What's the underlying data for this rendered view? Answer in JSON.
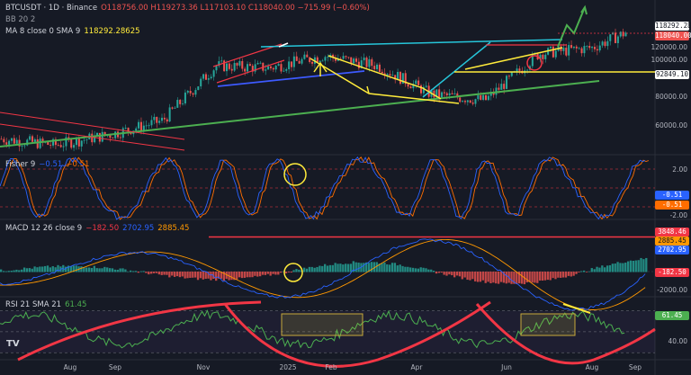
{
  "header": {
    "symbol": "BTCUSDT · 1D · Binance",
    "ohlc": "O118756.00 H119273.36 L117103.10 C118040.00 −715.99 (−0.60%)",
    "bb": "BB 20 2",
    "ma_label": "MA 8 close 0 SMA 9",
    "ma_value": "118292.28625"
  },
  "indicators": {
    "fisher": {
      "label": "Fisher 9",
      "v1": "−0.51",
      "v2": "−0.51"
    },
    "macd": {
      "label": "MACD 12 26 close 9",
      "v1": "−182.50",
      "v2": "2702.95",
      "v3": "2885.45"
    },
    "rsi": {
      "label": "RSI 21 SMA 21",
      "v1": "61.45"
    }
  },
  "price_axis": {
    "labels": [
      "120000.00",
      "100000.00",
      "80000.00",
      "60000.00"
    ],
    "tags": [
      {
        "text": "118292.28625",
        "bg": "#ffffff",
        "fg": "#131722"
      },
      {
        "text": "118040.00",
        "bg": "#ef5350",
        "fg": "#ffffff"
      },
      {
        "text": "92849.10",
        "bg": "#ffffff",
        "fg": "#131722"
      }
    ]
  },
  "fisher_axis": {
    "labels": [
      "2.00",
      "-2.00"
    ],
    "tags": [
      {
        "text": "-0.51",
        "bg": "#2962ff",
        "fg": "#ffffff"
      },
      {
        "text": "-0.51",
        "bg": "#ff6d00",
        "fg": "#ffffff"
      }
    ]
  },
  "macd_axis": {
    "labels": [
      "-2000.00"
    ],
    "tags": [
      {
        "text": "3848.46",
        "bg": "#f23645",
        "fg": "#ffffff"
      },
      {
        "text": "2885.45",
        "bg": "#ff9800",
        "fg": "#131722"
      },
      {
        "text": "2702.95",
        "bg": "#2962ff",
        "fg": "#ffffff"
      },
      {
        "text": "-182.50",
        "bg": "#f23645",
        "fg": "#ffffff"
      }
    ]
  },
  "rsi_axis": {
    "labels": [
      "40.00"
    ],
    "tags": [
      {
        "text": "61.45",
        "bg": "#4caf50",
        "fg": "#ffffff"
      }
    ]
  },
  "time_axis": [
    "Aug",
    "Sep",
    "Nov",
    "2025",
    "Feb",
    "Apr",
    "Jun",
    "Aug",
    "Sep"
  ],
  "colors": {
    "bg": "#161a25",
    "up": "#26a69a",
    "down": "#ef5350",
    "fisher": "#2962ff",
    "fisher_trigger": "#ff6d00",
    "rsi": "#4caf50",
    "macd": "#2962ff",
    "signal": "#ff9800",
    "annot_red": "#f23645",
    "annot_yellow": "#ffeb3b",
    "annot_blue": "#3d5afe",
    "annot_cyan": "#26c6da",
    "annot_green": "#4caf50",
    "rsi_band": "#7e57c2"
  },
  "chart_data": [
    {
      "type": "candlestick",
      "title": "BTCUSDT · 1D · Binance",
      "ylim": [
        55000,
        125000
      ],
      "y_ticks": [
        60000,
        80000,
        100000,
        120000
      ],
      "x_ticks": [
        "Aug",
        "Sep",
        "Nov",
        "2025",
        "Feb",
        "Apr",
        "Jun",
        "Aug",
        "Sep"
      ],
      "close_approx": [
        {
          "t": "Aug",
          "v": 61000
        },
        {
          "t": "Sep",
          "v": 58000
        },
        {
          "t": "Oct",
          "v": 63000
        },
        {
          "t": "Nov",
          "v": 70000
        },
        {
          "t": "Dec",
          "v": 97000
        },
        {
          "t": "2025",
          "v": 96000
        },
        {
          "t": "Jan",
          "v": 102000
        },
        {
          "t": "Feb",
          "v": 97000
        },
        {
          "t": "Mar",
          "v": 83000
        },
        {
          "t": "Apr",
          "v": 80000
        },
        {
          "t": "May",
          "v": 103000
        },
        {
          "t": "Jun",
          "v": 106000
        },
        {
          "t": "Jul",
          "v": 118040
        }
      ],
      "levels": [
        118292.28625,
        118040,
        92849.1
      ]
    },
    {
      "type": "line",
      "title": "Fisher 9",
      "series": [
        {
          "name": "Fisher",
          "last": -0.51
        },
        {
          "name": "Trigger",
          "last": -0.51
        }
      ],
      "y_ticks": [
        2.0,
        -2.0
      ]
    },
    {
      "type": "bar",
      "title": "MACD 12 26 close 9",
      "series": [
        {
          "name": "Histogram",
          "last": -182.5
        },
        {
          "name": "MACD",
          "last": 2702.95
        },
        {
          "name": "Signal",
          "last": 2885.45
        }
      ],
      "levels": [
        3848.46
      ],
      "y_ticks": [
        -2000
      ]
    },
    {
      "type": "line",
      "title": "RSI 21 SMA 21",
      "series": [
        {
          "name": "RSI",
          "last": 61.45
        }
      ],
      "y_ticks": [
        40
      ]
    }
  ]
}
